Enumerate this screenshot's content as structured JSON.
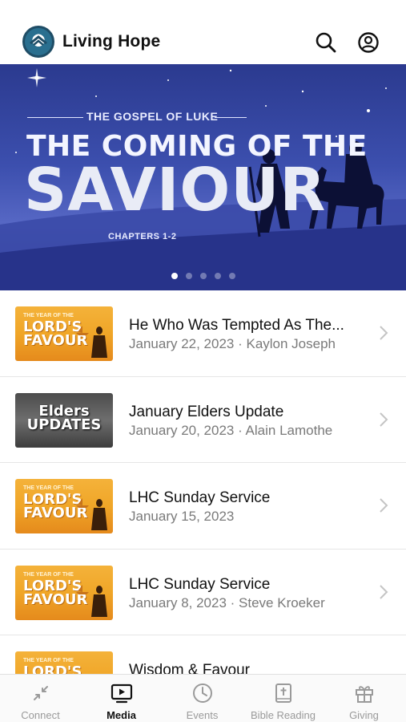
{
  "header": {
    "app_title": "Living Hope",
    "icons": [
      "search-icon",
      "account-icon"
    ]
  },
  "banner": {
    "series": "THE GOSPEL OF LUKE",
    "title_line1": "THE COMING OF THE",
    "title_line2": "SAVIOUR",
    "chapters": "CHAPTERS 1-2",
    "slide_count": 5,
    "active_slide": 1
  },
  "thumbnails": {
    "favour_small": "THE YEAR OF THE",
    "favour_line1": "LORD'S",
    "favour_line2": "FAVOUR",
    "elders_line1": "Elders",
    "elders_line2": "UPDATES"
  },
  "media_items": [
    {
      "title": "He Who Was Tempted As The...",
      "subtitle": "January 22, 2023 · Kaylon Joseph",
      "thumb": "favour"
    },
    {
      "title": "January Elders Update",
      "subtitle": "January 20, 2023 · Alain Lamothe",
      "thumb": "elders"
    },
    {
      "title": "LHC Sunday Service",
      "subtitle": "January 15, 2023",
      "thumb": "favour"
    },
    {
      "title": "LHC Sunday Service",
      "subtitle": "January 8, 2023 · Steve Kroeker",
      "thumb": "favour"
    },
    {
      "title": "Wisdom & Favour",
      "subtitle": "",
      "thumb": "favour"
    }
  ],
  "tabbar": {
    "tabs": [
      {
        "label": "Connect",
        "icon": "connect-icon",
        "active": false
      },
      {
        "label": "Media",
        "icon": "media-icon",
        "active": true
      },
      {
        "label": "Events",
        "icon": "clock-icon",
        "active": false
      },
      {
        "label": "Bible Reading",
        "icon": "bible-icon",
        "active": false
      },
      {
        "label": "Giving",
        "icon": "gift-icon",
        "active": false
      }
    ]
  },
  "colors": {
    "banner_top": "#2b3a8f",
    "thumb_orange": "#f0a628",
    "inactive_tab": "#9a9a9a"
  }
}
